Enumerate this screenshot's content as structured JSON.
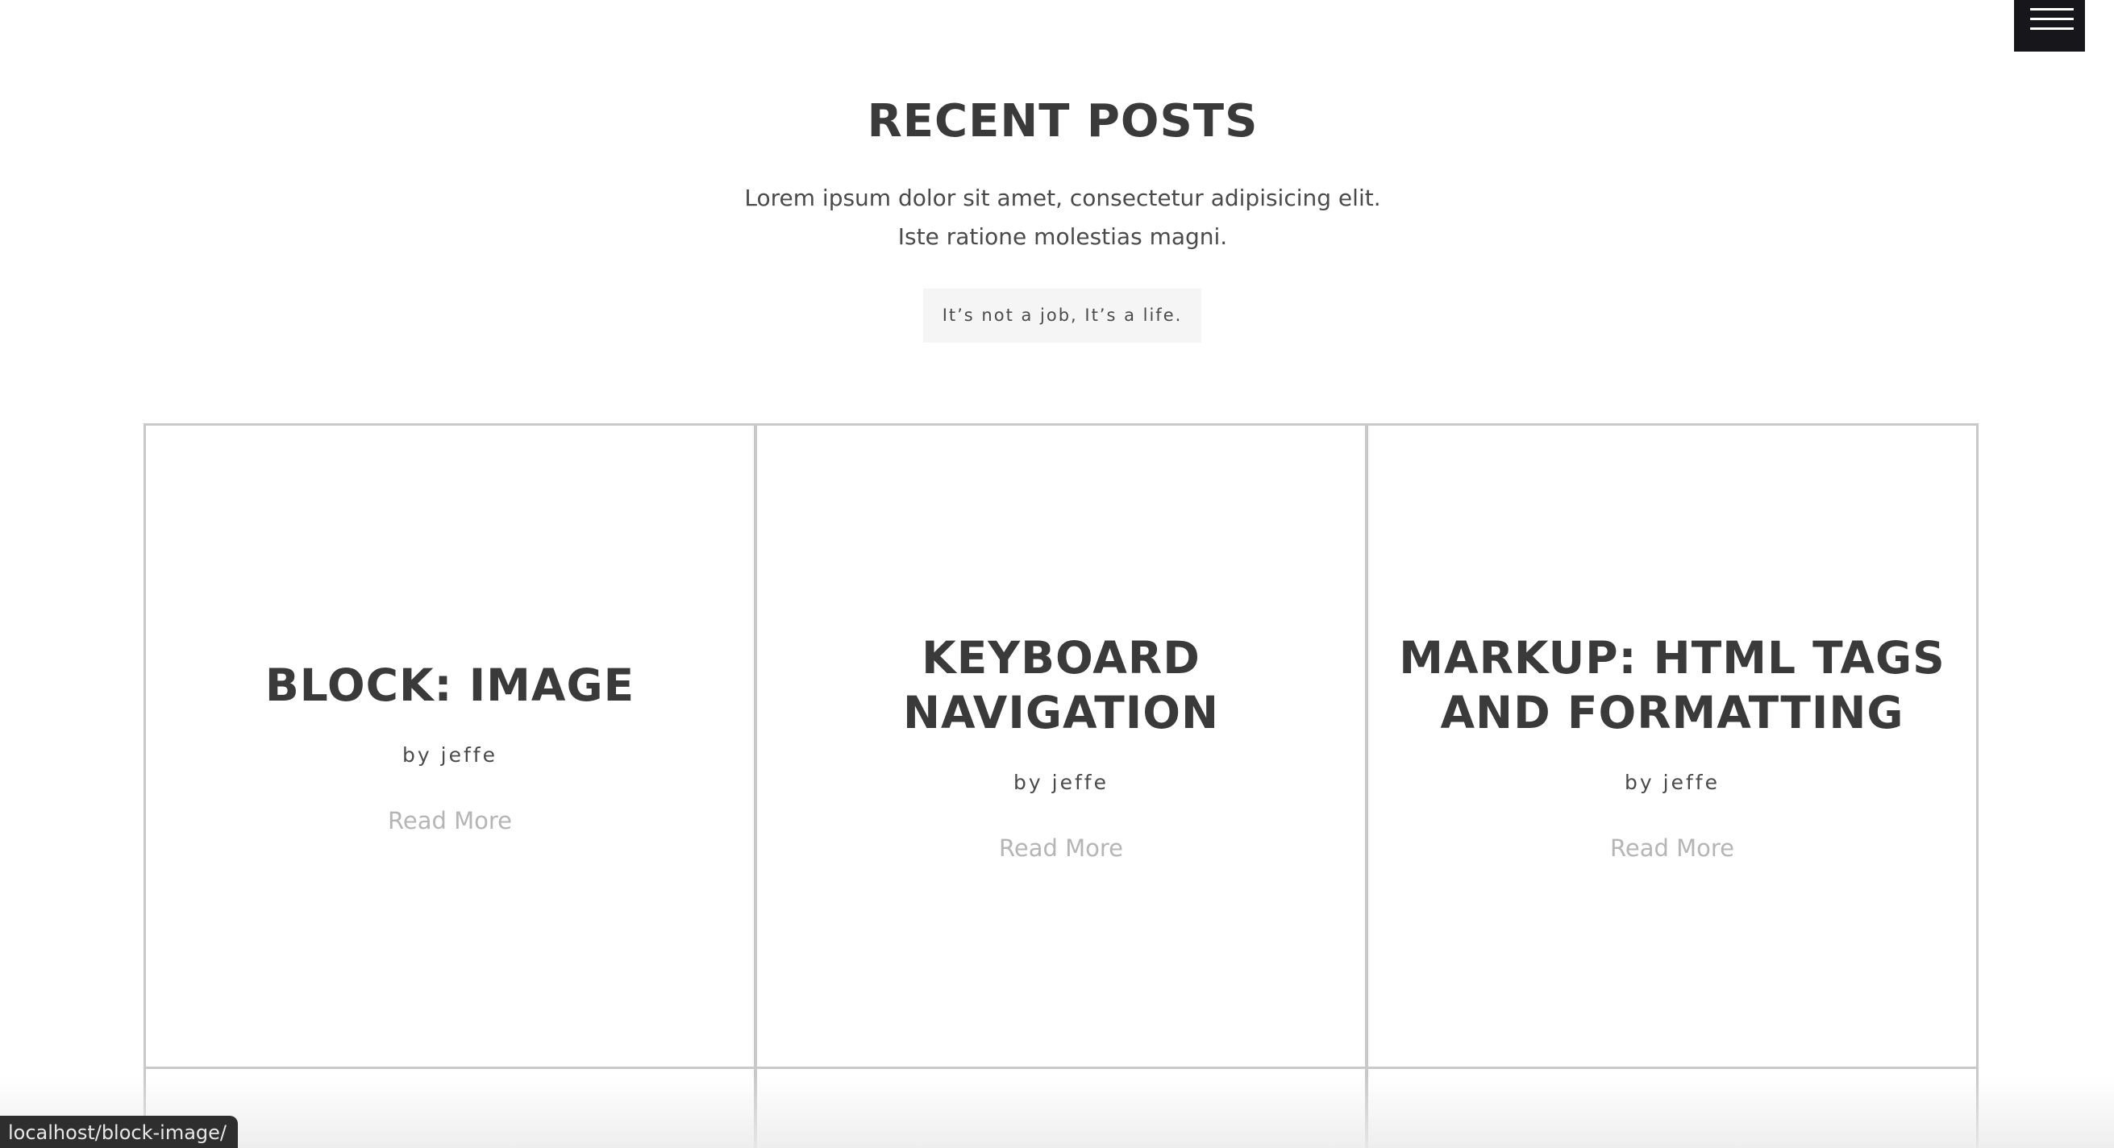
{
  "menu": {
    "icon": "hamburger-menu-icon"
  },
  "section": {
    "title": "RECENT POSTS",
    "description_line1": "Lorem ipsum dolor sit amet, consectetur adipisicing elit.",
    "description_line2": "Iste ratione molestias magni.",
    "tagline": "It’s not a job, It’s a life."
  },
  "posts": [
    {
      "title": "BLOCK: IMAGE",
      "author": "by jeffe",
      "read_more": "Read More"
    },
    {
      "title": "KEYBOARD NAVIGATION",
      "author": "by jeffe",
      "read_more": "Read More"
    },
    {
      "title": "MARKUP: HTML TAGS AND FORMATTING",
      "author": "by jeffe",
      "read_more": "Read More"
    }
  ],
  "status_bar": {
    "url": "localhost/block-image/"
  },
  "colors": {
    "menu_background": "#17171b",
    "card_border": "#c9c9c9",
    "heading_text": "#3a3a3a",
    "read_more_text": "#b5b5b5",
    "tagline_background": "#f5f5f5"
  }
}
